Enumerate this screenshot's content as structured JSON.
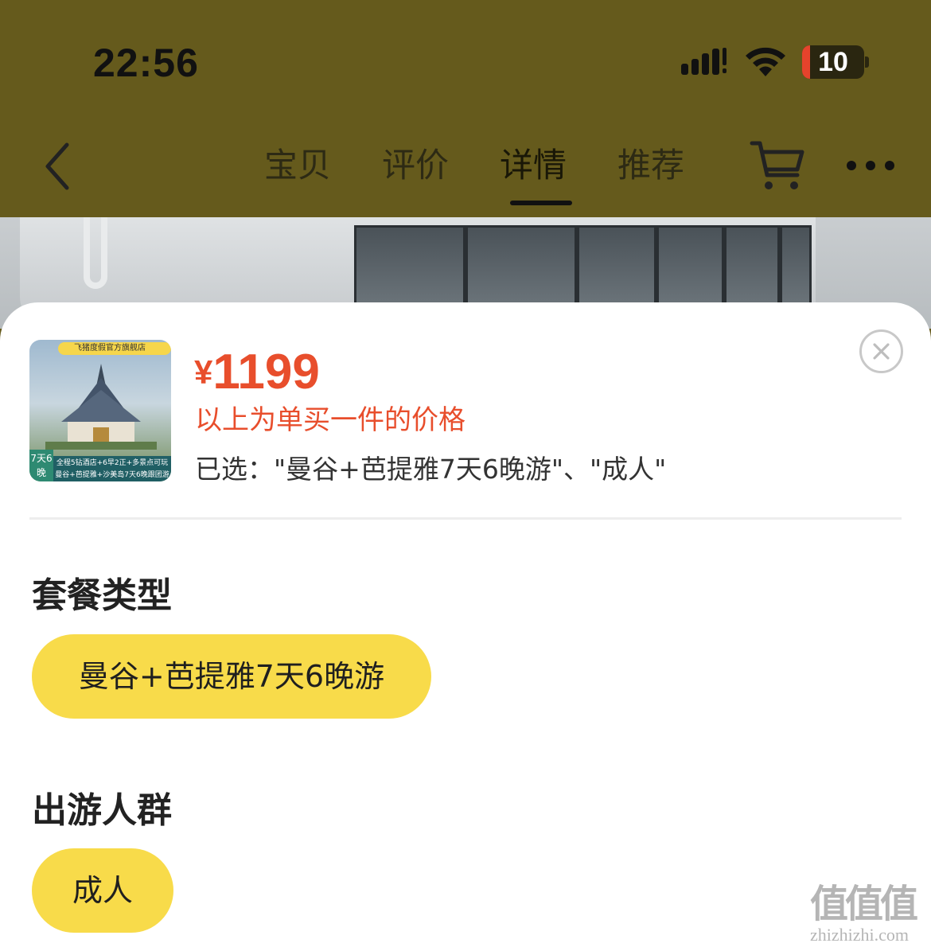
{
  "status_bar": {
    "time": "22:56",
    "battery": "10"
  },
  "nav": {
    "tabs": [
      {
        "label": "宝贝",
        "active": false
      },
      {
        "label": "评价",
        "active": false
      },
      {
        "label": "详情",
        "active": true
      },
      {
        "label": "推荐",
        "active": false
      }
    ]
  },
  "sku_sheet": {
    "thumbnail": {
      "badge": "飞猪度假官方旗舰店",
      "days": "7天6晚",
      "caption_line1": "全程5钻酒店+6早2正+多景点可玩",
      "caption_line2": "曼谷+芭提雅+沙美岛7天6晚跟团游"
    },
    "price_symbol": "¥",
    "price": "1199",
    "price_note": "以上为单买一件的价格",
    "selected": "已选：\"曼谷+芭提雅7天6晚游\"、\"成人\"",
    "groups": [
      {
        "title": "套餐类型",
        "options": [
          {
            "label": "曼谷+芭提雅7天6晚游",
            "selected": true
          }
        ]
      },
      {
        "title": "出游人群",
        "options": [
          {
            "label": "成人",
            "selected": true
          }
        ]
      }
    ]
  },
  "watermark": {
    "logo": "值值值",
    "url": "zhizhizhi.com"
  },
  "colors": {
    "header_bg": "#655a1c",
    "price": "#e84e2c",
    "option_selected": "#f8db4a"
  }
}
